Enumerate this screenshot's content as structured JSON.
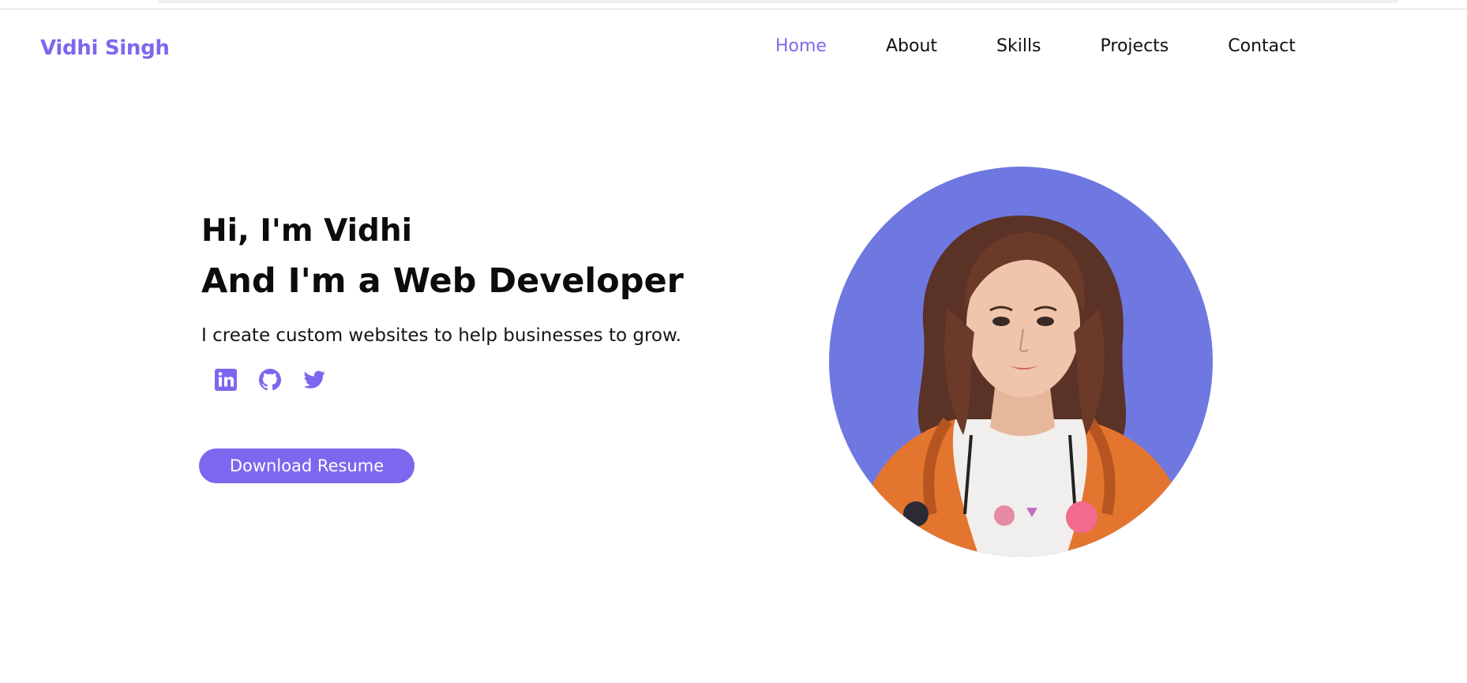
{
  "brand": {
    "name": "Vidhi Singh",
    "accent_color": "#7b68ee",
    "avatar_bg_color": "#6e78e0"
  },
  "nav": {
    "items": [
      {
        "label": "Home",
        "active": true
      },
      {
        "label": "About",
        "active": false
      },
      {
        "label": "Skills",
        "active": false
      },
      {
        "label": "Projects",
        "active": false
      },
      {
        "label": "Contact",
        "active": false
      }
    ]
  },
  "hero": {
    "greeting": "Hi, I'm Vidhi",
    "headline": "And I'm a Web Developer",
    "tagline": "I create custom websites to help businesses to grow.",
    "socials": [
      {
        "icon": "linkedin-icon"
      },
      {
        "icon": "github-icon"
      },
      {
        "icon": "twitter-icon"
      }
    ],
    "resume_button": "Download Resume"
  }
}
